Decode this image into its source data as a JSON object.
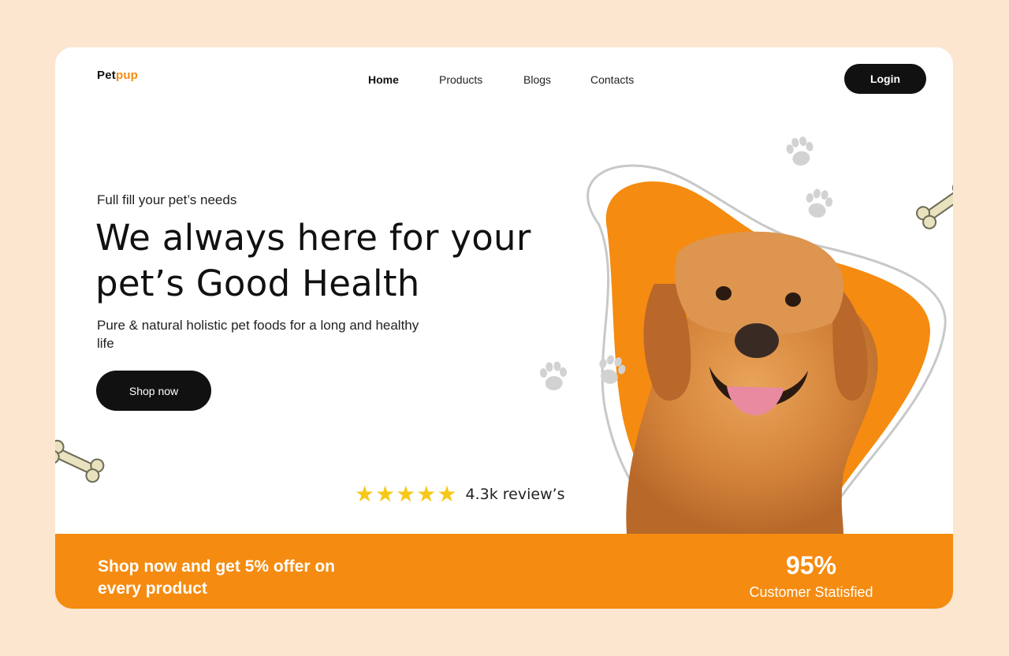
{
  "brand": {
    "name_part1": "Pet",
    "name_part2": "pup"
  },
  "nav": {
    "items": [
      {
        "label": "Home",
        "active": true
      },
      {
        "label": "Products",
        "active": false
      },
      {
        "label": "Blogs",
        "active": false
      },
      {
        "label": "Contacts",
        "active": false
      }
    ],
    "login_label": "Login"
  },
  "hero": {
    "kicker": "Full fill your pet’s needs",
    "headline_line1": "We always here for your",
    "headline_line2": "pet’s Good Health",
    "subtitle": "Pure & natural holistic pet foods for a long and healthy life",
    "cta_label": "Shop now"
  },
  "rating": {
    "stars": 5,
    "reviews_text": "4.3k review’s"
  },
  "banner": {
    "offer_text": "Shop now and get 5% offer on every product",
    "stat_value": "95%",
    "stat_label": "Customer Statisfied"
  },
  "colors": {
    "accent": "#f58b10",
    "dark": "#111111",
    "page_background": "#fde6d0",
    "star": "#f6c818"
  },
  "icons": [
    "paw-print-icon",
    "bone-icon",
    "star-icon"
  ]
}
